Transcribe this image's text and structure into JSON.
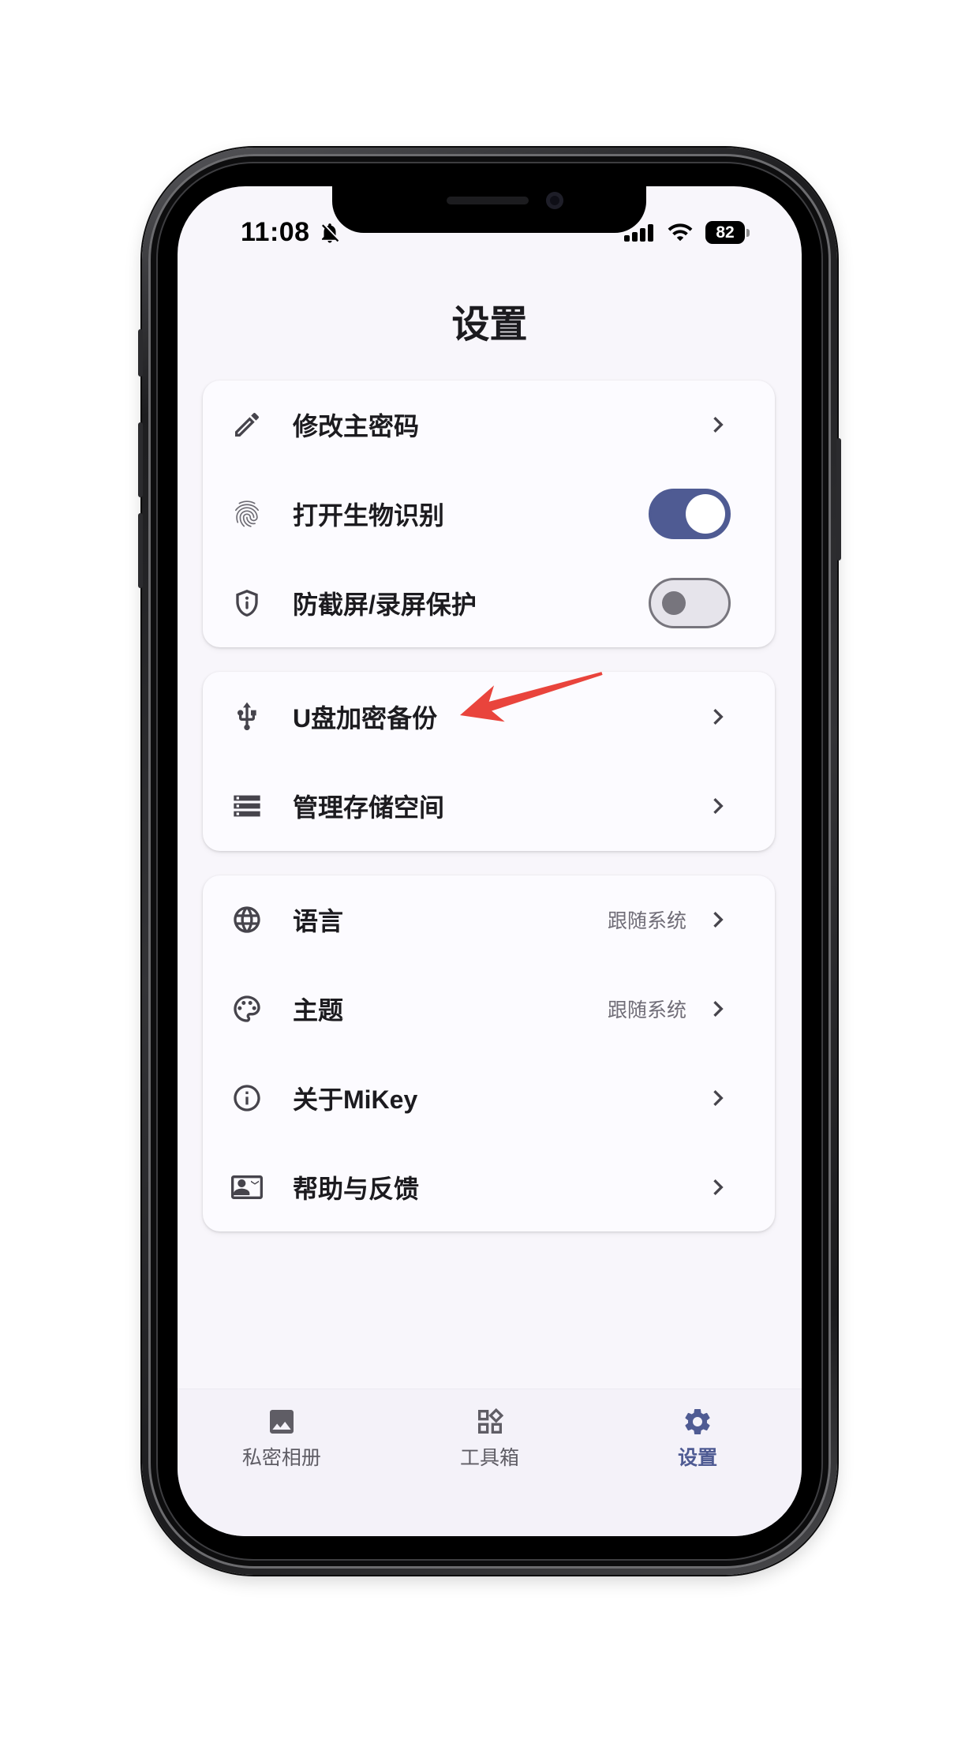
{
  "status_bar": {
    "time": "11:08",
    "battery": "82",
    "icons": [
      "bell-slash-icon",
      "signal-icon",
      "wifi-icon",
      "battery-icon"
    ]
  },
  "page": {
    "title": "设置"
  },
  "groups": [
    {
      "items": [
        {
          "label": "修改主密码",
          "icon": "edit-icon"
        },
        {
          "label": "打开生物识别",
          "icon": "fingerprint-icon",
          "toggle": true
        },
        {
          "label": "防截屏/录屏保护",
          "icon": "shield-info-icon",
          "toggle": false
        }
      ]
    },
    {
      "items": [
        {
          "label": "U盘加密备份",
          "icon": "usb-icon"
        },
        {
          "label": "管理存储空间",
          "icon": "storage-icon"
        }
      ]
    },
    {
      "items": [
        {
          "label": "语言",
          "icon": "language-icon",
          "value": "跟随系统"
        },
        {
          "label": "主题",
          "icon": "palette-icon",
          "value": "跟随系统"
        },
        {
          "label": "关于MiKey",
          "icon": "info-icon"
        },
        {
          "label": "帮助与反馈",
          "icon": "contact-card-icon"
        }
      ]
    }
  ],
  "bottom_nav": {
    "items": [
      {
        "label": "私密相册",
        "icon": "image-icon",
        "active": false
      },
      {
        "label": "工具箱",
        "icon": "widgets-icon",
        "active": false
      },
      {
        "label": "设置",
        "icon": "gear-icon",
        "active": true
      }
    ]
  },
  "annotation": {
    "icon": "red-arrow-icon",
    "color": "#e9443c"
  },
  "theme": {
    "accent": "#4f5b93"
  }
}
